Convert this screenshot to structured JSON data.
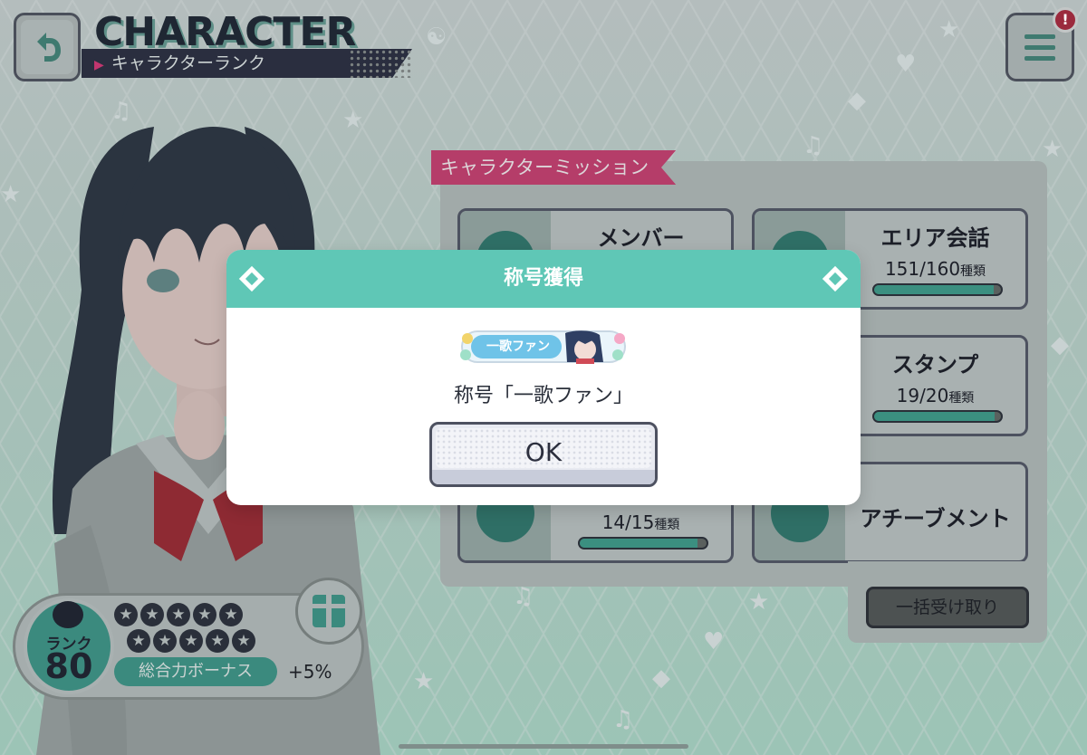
{
  "header": {
    "title": "CHARACTER",
    "subtitle": "キャラクターランク",
    "notification_badge": "!"
  },
  "mission": {
    "tag": "キャラクターミッション",
    "cards": [
      {
        "name": "メンバー",
        "count": "",
        "unit": ""
      },
      {
        "name": "エリア会話",
        "count": "151/160",
        "unit": "種類",
        "progress": 0.94
      },
      {
        "name": "",
        "count": "",
        "unit": ""
      },
      {
        "name": "スタンプ",
        "count": "19/20",
        "unit": "種類",
        "progress": 0.95
      },
      {
        "name": "",
        "count": "14/15",
        "unit": "種類",
        "progress": 0.93
      },
      {
        "name": "アチーブメント",
        "count": "",
        "unit": ""
      }
    ],
    "bulk_receive": "一括受け取り"
  },
  "rank": {
    "label": "ランク",
    "value": "80",
    "stars_total": 10,
    "bonus_label": "総合力ボーナス",
    "bonus_value": "+5%"
  },
  "dialog": {
    "title": "称号獲得",
    "plate_text": "一歌ファン",
    "message": "称号「一歌ファン」",
    "ok_label": "OK"
  },
  "colors": {
    "dialog_header": "#5fc7b6",
    "accent_teal": "#3b8a7e",
    "mission_tag": "#b53d69",
    "dark_navy": "#2a2e3f"
  }
}
